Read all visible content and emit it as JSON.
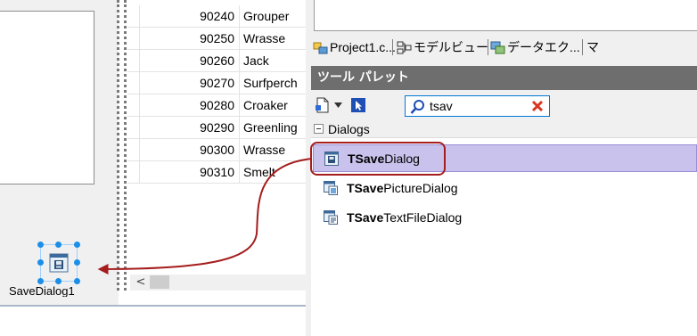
{
  "designer": {
    "grid_rows": [
      {
        "code": "90240",
        "name": "Grouper"
      },
      {
        "code": "90250",
        "name": "Wrasse"
      },
      {
        "code": "90260",
        "name": "Jack"
      },
      {
        "code": "90270",
        "name": "Surfperch"
      },
      {
        "code": "90280",
        "name": "Croaker"
      },
      {
        "code": "90290",
        "name": "Greenling"
      },
      {
        "code": "90300",
        "name": "Wrasse"
      },
      {
        "code": "90310",
        "name": "Smelt"
      }
    ],
    "component_caption": "SaveDialog1",
    "scroll_left_glyph": "<"
  },
  "tabs": [
    {
      "label": "Project1.c...",
      "icon": "project-icon"
    },
    {
      "label": "モデルビュー",
      "icon": "model-view-icon"
    },
    {
      "label": "データエク...",
      "icon": "data-explorer-icon"
    },
    {
      "label": "マ",
      "icon": ""
    }
  ],
  "palette": {
    "title": "ツール パレット",
    "search_value": "tsav",
    "category": "Dialogs",
    "items": [
      {
        "match": "TSave",
        "rest": "Dialog",
        "selected": true
      },
      {
        "match": "TSave",
        "rest": "PictureDialog",
        "selected": false
      },
      {
        "match": "TSave",
        "rest": "TextFileDialog",
        "selected": false
      }
    ]
  },
  "colors": {
    "accent_selection": "#c8c2ec",
    "annotation_red": "#a51d1d",
    "palette_header": "#6e6e6e"
  }
}
